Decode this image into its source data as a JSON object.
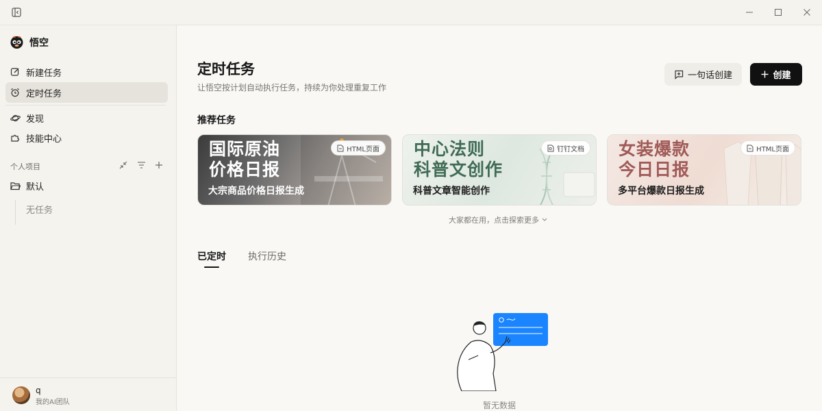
{
  "sidebar": {
    "brand": "悟空",
    "nav": [
      {
        "label": "新建任务",
        "icon": "edit-icon"
      },
      {
        "label": "定时任务",
        "icon": "alarm-clock-icon"
      },
      {
        "label": "发现",
        "icon": "planet-icon"
      },
      {
        "label": "技能中心",
        "icon": "puzzle-icon"
      }
    ],
    "section_label": "个人项目",
    "project": {
      "label": "默认",
      "icon": "folder-icon"
    },
    "empty_project": "无任务",
    "user": {
      "name": "q",
      "team": "我的AI团队"
    }
  },
  "main": {
    "title": "定时任务",
    "subtitle": "让悟空按计划自动执行任务，持续为你处理重复工作",
    "quick_create_label": "一句话创建",
    "create_label": "创建",
    "recommended_title": "推荐任务",
    "cards": [
      {
        "headline_1": "国际原油",
        "headline_2": "价格日报",
        "description": "大宗商品价格日报生成",
        "badge": "HTML页面"
      },
      {
        "headline_1": "中心法则",
        "headline_2": "科普文创作",
        "description": "科普文章智能创作",
        "badge": "钉钉文档"
      },
      {
        "headline_1": "女装爆款",
        "headline_2": "今日日报",
        "description": "多平台爆款日报生成",
        "badge": "HTML页面"
      }
    ],
    "explore_more": "大家都在用，点击探索更多",
    "tabs": [
      {
        "label": "已定时",
        "active": true
      },
      {
        "label": "执行历史",
        "active": false
      }
    ],
    "empty_text": "暂无数据"
  },
  "colors": {
    "primary_button": "#111111",
    "active_nav": "#e5e3dc",
    "illustration_accent": "#1a85ff"
  }
}
